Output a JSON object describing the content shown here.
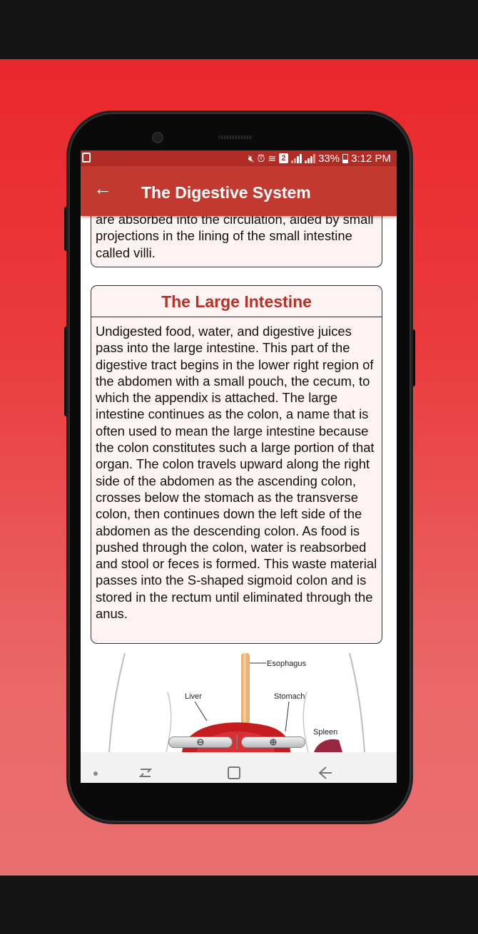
{
  "status_bar": {
    "battery_percent": "33%",
    "time": "3:12 PM",
    "sim_badge": "2"
  },
  "toolbar": {
    "title": "The Digestive System"
  },
  "section_prev": {
    "tail_text": "are absorbed into the circulation, aided by small projections in the lining of the small intestine called villi."
  },
  "section_large_intestine": {
    "title": "The Large Intestine",
    "body": "Undigested food, water, and digestive juices pass into the large intestine. This part of the digestive tract begins in the lower right region of the abdomen with a small pouch, the cecum, to which the appendix is attached. The large intestine continues as the colon, a name that is often used to mean the large intestine because the colon constitutes such a large portion of that organ. The colon travels upward along the right side of the abdomen as the ascending colon, crosses below the stomach as the transverse colon, then continues down the left side of the abdomen as the descending colon. As food is pushed through the colon, water is reabsorbed and stool or feces is formed. This waste material passes into the S-shaped sigmoid colon and is stored in the rectum until eliminated through the anus."
  },
  "diagram": {
    "labels": {
      "esophagus": "Esophagus",
      "liver": "Liver",
      "stomach": "Stomach",
      "spleen": "Spleen"
    }
  },
  "zoom_controls": {
    "zoom_out_icon": "zoom-out-icon",
    "zoom_in_icon": "zoom-in-icon"
  },
  "colors": {
    "background_red": "#e9282c",
    "toolbar": "#c23a2f",
    "status_bar": "#b22c26",
    "card_title": "#b83026",
    "card_background": "#fef3f3"
  }
}
